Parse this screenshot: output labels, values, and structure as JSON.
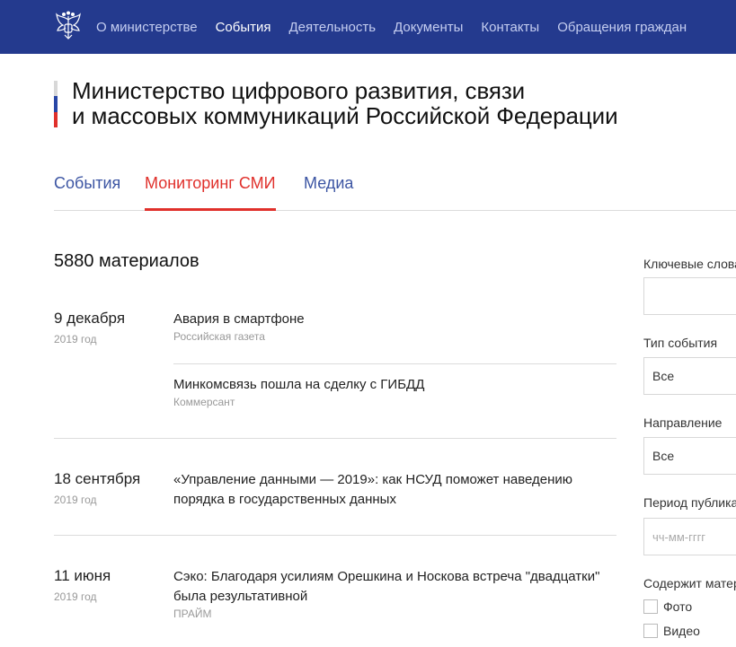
{
  "nav": {
    "items": [
      {
        "label": "О министерстве",
        "active": false
      },
      {
        "label": "События",
        "active": true
      },
      {
        "label": "Деятельность",
        "active": false
      },
      {
        "label": "Документы",
        "active": false
      },
      {
        "label": "Контакты",
        "active": false
      },
      {
        "label": "Обращения граждан",
        "active": false
      }
    ]
  },
  "header": {
    "title_line1": "Министерство цифрового развития, связи",
    "title_line2": "и массовых коммуникаций Российской Федерации"
  },
  "tabs": [
    {
      "label": "События",
      "active": false
    },
    {
      "label": "Мониторинг СМИ",
      "active": true
    },
    {
      "label": "Медиа",
      "active": false
    }
  ],
  "list": {
    "count": "5880 материалов",
    "groups": [
      {
        "date": "9 декабря",
        "year": "2019 год",
        "items": [
          {
            "title": "Авария в смартфоне",
            "source": "Российская газета"
          },
          {
            "title": "Минкомсвязь пошла на сделку с ГИБДД",
            "source": "Коммерсант"
          }
        ]
      },
      {
        "date": "18 сентября",
        "year": "2019 год",
        "items": [
          {
            "title": "«Управление данными — 2019»: как НСУД поможет наведению порядка в государственных данных",
            "source": ""
          }
        ]
      },
      {
        "date": "11 июня",
        "year": "2019 год",
        "items": [
          {
            "title": "Сэко: Благодаря усилиям Орешкина и Носкова встреча \"двадцатки\" была результативной",
            "source": "ПРАЙМ"
          }
        ]
      }
    ]
  },
  "filters": {
    "keywords_label": "Ключевые слова",
    "event_type_label": "Тип события",
    "event_type_value": "Все",
    "direction_label": "Направление",
    "direction_value": "Все",
    "period_label": "Период публикации",
    "period_placeholder": "чч-мм-гггг",
    "contains_label": "Содержит материалы",
    "contains_options": [
      "Фото",
      "Видео"
    ]
  },
  "colors": {
    "nav_bg": "#243a8e",
    "accent_red": "#e0302b",
    "link_blue": "#3c55a3"
  }
}
